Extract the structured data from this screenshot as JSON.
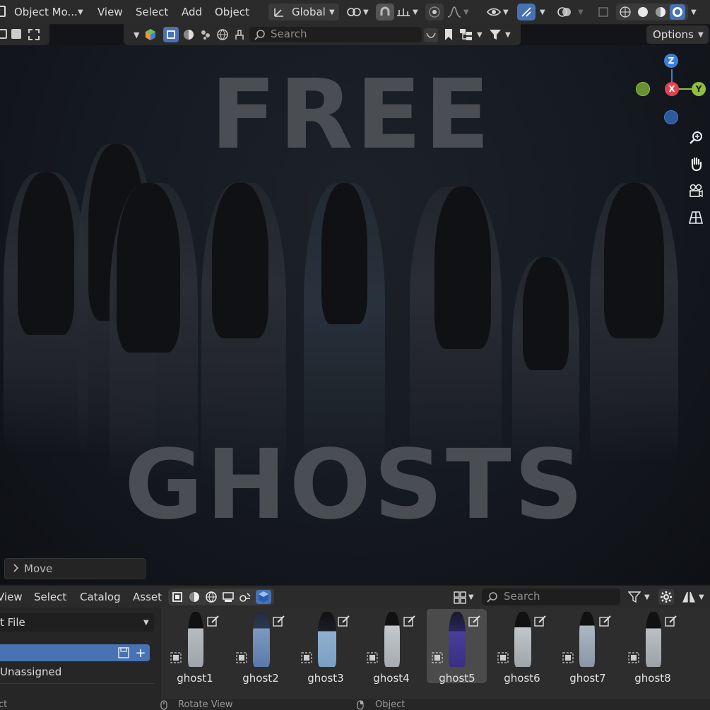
{
  "header": {
    "mode_label": "Object Mo...",
    "menus": [
      "View",
      "Select",
      "Add",
      "Object"
    ],
    "orientation_label": "Global",
    "options_label": "Options"
  },
  "viewport_header": {
    "search_placeholder": "Search"
  },
  "viewport": {
    "title_line1": "FREE",
    "title_line2": "GHOSTS",
    "gizmo": {
      "z": "Z",
      "x": "X",
      "y": "Y"
    },
    "last_operator": "Move"
  },
  "asset_browser": {
    "menus": [
      "View",
      "Select",
      "Catalog",
      "Asset"
    ],
    "search_placeholder": "Search",
    "library_select": "t File",
    "catalog_unassigned": "Unassigned",
    "items": [
      {
        "label": "ghost1"
      },
      {
        "label": "ghost2"
      },
      {
        "label": "ghost3"
      },
      {
        "label": "ghost4"
      },
      {
        "label": "ghost5",
        "selected": true
      },
      {
        "label": "ghost6"
      },
      {
        "label": "ghost7"
      },
      {
        "label": "ghost8"
      }
    ]
  },
  "status_bar": {
    "left": "ct",
    "middle": "Rotate View",
    "right": "Object"
  },
  "colors": {
    "accent": "#4772b3",
    "gizmo_x": "#e0454f",
    "gizmo_y": "#8dc03f",
    "gizmo_z": "#3f7fd6"
  }
}
